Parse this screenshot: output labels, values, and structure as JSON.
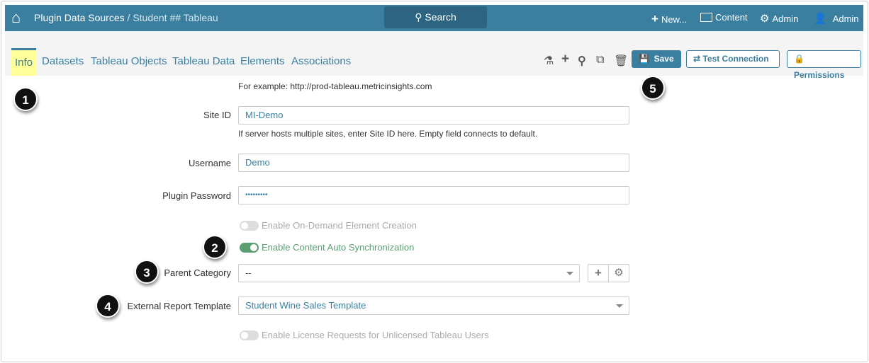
{
  "header": {
    "breadcrumb_root": "Plugin Data Sources",
    "breadcrumb_sep": " / ",
    "breadcrumb_current": "Student ## Tableau",
    "search_label": "Search",
    "new_label": "New...",
    "content_label": "Content",
    "admin_label": "Admin",
    "user_label": "Admin"
  },
  "tabs": [
    {
      "label": "Info"
    },
    {
      "label": "Datasets"
    },
    {
      "label": "Tableau Objects"
    },
    {
      "label": "Tableau Data"
    },
    {
      "label": "Elements"
    },
    {
      "label": "Associations"
    }
  ],
  "toolbar": {
    "save_label": "Save",
    "test_label": "Test Connection",
    "permissions_label": "Permissions"
  },
  "form": {
    "server_hint": "For example: http://prod-tableau.metricinsights.com",
    "site_id_label": "Site ID",
    "site_id_value": "MI-Demo",
    "site_id_hint": "If server hosts multiple sites, enter Site ID here. Empty field connects to default.",
    "username_label": "Username",
    "username_value": "Demo",
    "password_label": "Plugin Password",
    "password_value": "•••••••••",
    "on_demand_label": "Enable On-Demand Element Creation",
    "on_demand_on": false,
    "auto_sync_label": "Enable Content Auto Synchronization",
    "auto_sync_on": true,
    "parent_category_label": "Parent Category",
    "parent_category_value": "--",
    "template_label": "External Report Template",
    "template_value": "Student Wine Sales Template",
    "license_label": "Enable License Requests for Unlicensed Tableau Users",
    "license_on": false
  },
  "badges": [
    "1",
    "2",
    "3",
    "4",
    "5"
  ],
  "colors": {
    "accent": "#3a7fa0",
    "toggle_on": "#5a9e72",
    "tab_highlight": "#ffff99"
  }
}
